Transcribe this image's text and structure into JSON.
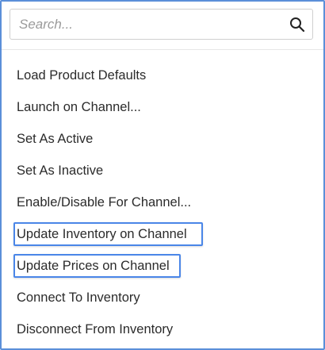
{
  "search": {
    "placeholder": "Search...",
    "value": "",
    "icon": "search-icon"
  },
  "menu": {
    "items": [
      {
        "label": "Load Product Defaults",
        "highlighted": false
      },
      {
        "label": "Launch on Channel...",
        "highlighted": false
      },
      {
        "label": "Set As Active",
        "highlighted": false
      },
      {
        "label": "Set As Inactive",
        "highlighted": false
      },
      {
        "label": "Enable/Disable For Channel...",
        "highlighted": false
      },
      {
        "label": "Update Inventory on Channel",
        "highlighted": true
      },
      {
        "label": "Update Prices on Channel",
        "highlighted": true
      },
      {
        "label": "Connect To Inventory",
        "highlighted": false
      },
      {
        "label": "Disconnect From Inventory",
        "highlighted": false
      }
    ]
  },
  "colors": {
    "panel_border": "#5b8fd9",
    "highlight_border": "#4a86e8",
    "text": "#2b2b2b",
    "placeholder": "#9a9a9a"
  }
}
